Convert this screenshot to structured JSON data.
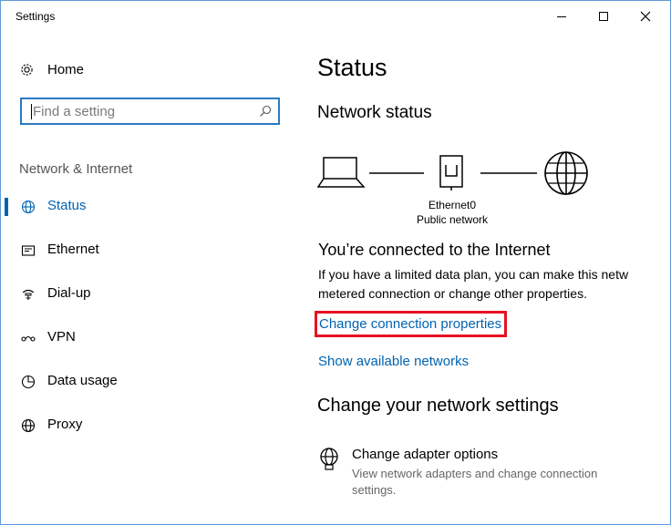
{
  "window": {
    "title": "Settings"
  },
  "titlebar": {
    "minimize_icon": "minimize-icon",
    "maximize_icon": "maximize-icon",
    "close_icon": "close-icon"
  },
  "sidebar": {
    "home_label": "Home",
    "search_placeholder": "Find a setting",
    "section_label": "Network & Internet",
    "items": [
      {
        "label": "Status",
        "icon": "globe-icon",
        "active": true
      },
      {
        "label": "Ethernet",
        "icon": "ethernet-icon",
        "active": false
      },
      {
        "label": "Dial-up",
        "icon": "dialup-icon",
        "active": false
      },
      {
        "label": "VPN",
        "icon": "vpn-icon",
        "active": false
      },
      {
        "label": "Data usage",
        "icon": "data-usage-icon",
        "active": false
      },
      {
        "label": "Proxy",
        "icon": "proxy-icon",
        "active": false
      }
    ]
  },
  "main": {
    "title": "Status",
    "network_status_heading": "Network status",
    "network_name": "Ethernet0",
    "network_type": "Public network",
    "connected_heading": "You’re connected to the Internet",
    "connected_desc_line1": "If you have a limited data plan, you can make this netw",
    "connected_desc_line2": "metered connection or change other properties.",
    "change_connection_link": "Change connection properties",
    "show_networks_link": "Show available networks",
    "change_settings_heading": "Change your network settings",
    "adapter_title": "Change adapter options",
    "adapter_desc": "View network adapters and change connection settings."
  },
  "colors": {
    "accent": "#0063b1",
    "highlight_border": "#e81123",
    "search_border": "#2b79c2"
  }
}
